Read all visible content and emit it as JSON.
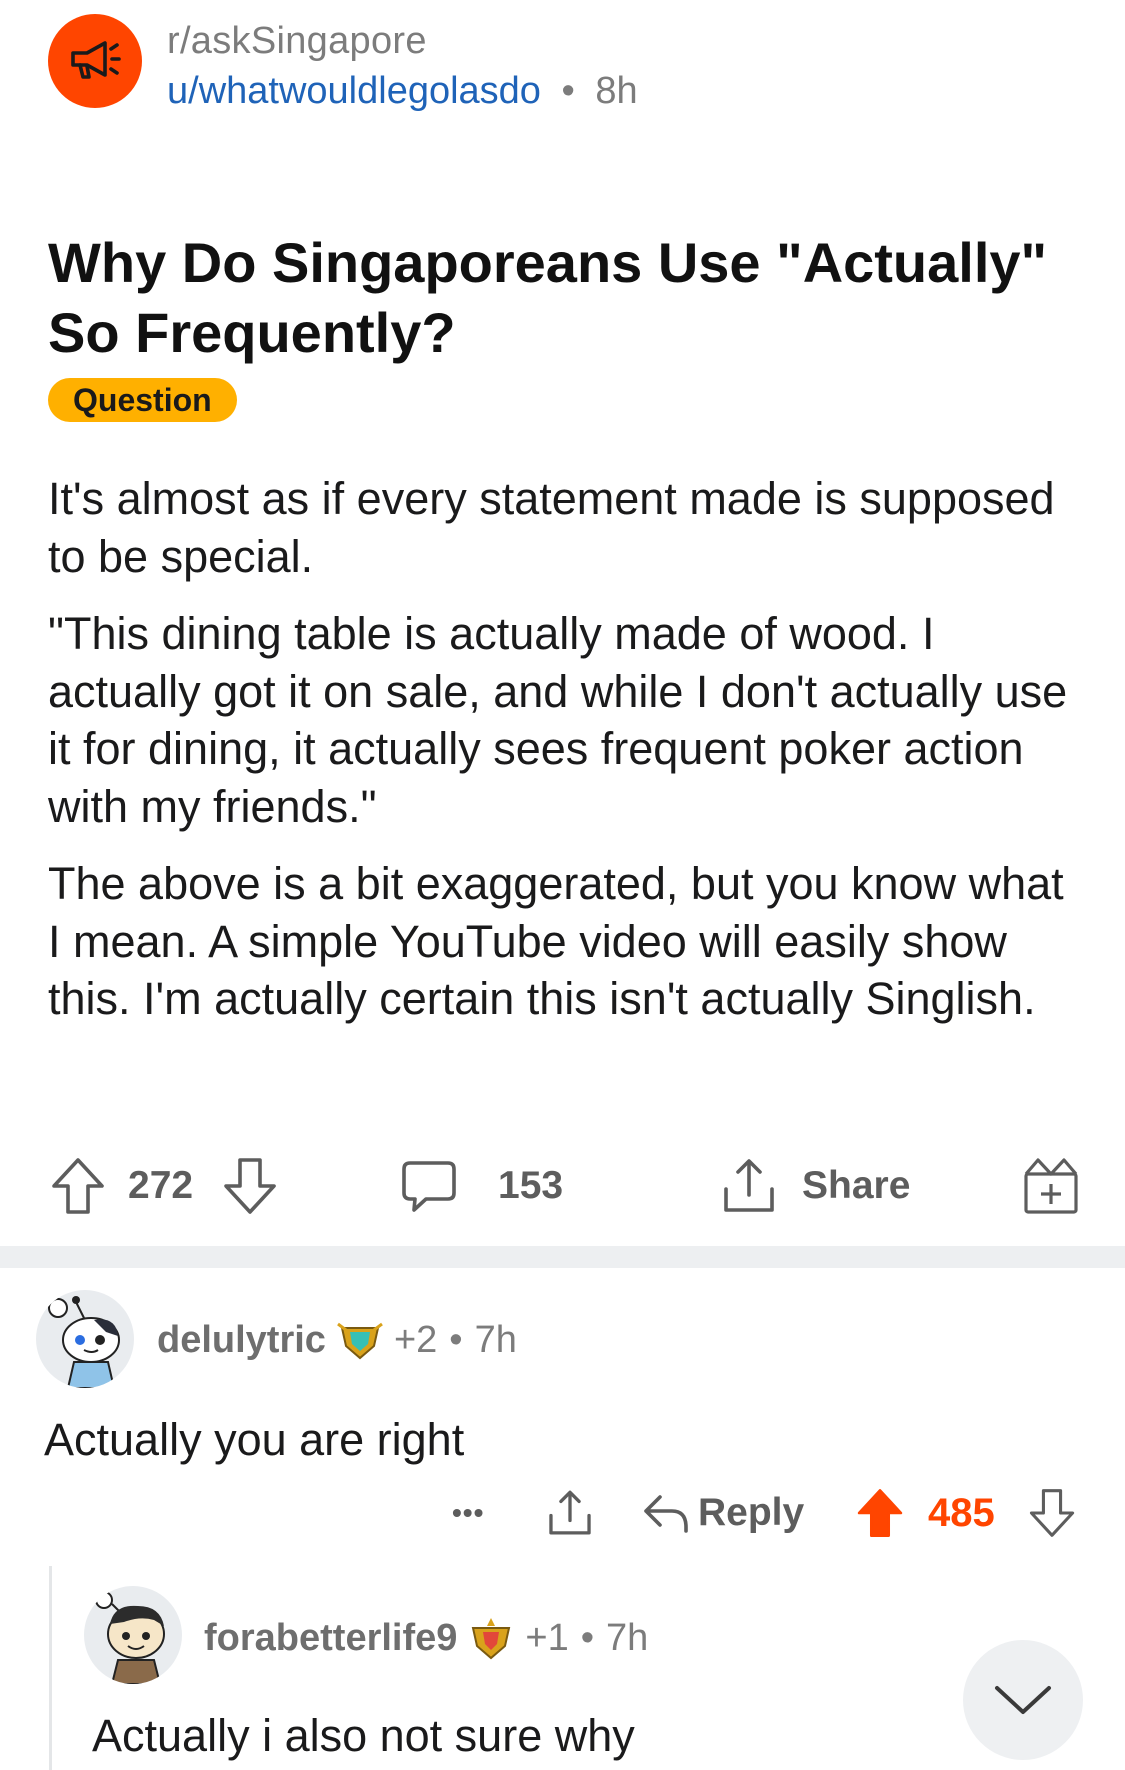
{
  "post": {
    "subreddit": "r/askSingapore",
    "author": "u/whatwouldlegolasdo",
    "separator": "•",
    "age": "8h",
    "title": "Why Do Singaporeans Use \"Actually\" So Frequently?",
    "flair": "Question",
    "flair_color": "#ffb000",
    "body": [
      "It's almost as if every statement made is supposed to be special.",
      "\"This dining table is actually made of wood. I actually got it on sale, and while I don't actually use it for dining, it actually sees frequent poker action with my friends.\"",
      "The above is a bit exaggerated, but you know what I mean. A simple YouTube video will easily show this. I'm actually certain this isn't actually Singlish."
    ],
    "votes": "272",
    "comments": "153",
    "share_label": "Share"
  },
  "comments": [
    {
      "username": "delulytric",
      "karma": "+2",
      "separator": "•",
      "age": "7h",
      "body": "Actually you are right",
      "more": "•••",
      "reply_label": "Reply",
      "score": "485",
      "score_color": "#ff4500"
    },
    {
      "username": "forabetterlife9",
      "karma": "+1",
      "separator": "•",
      "age": "7h",
      "body": "Actually i also not sure why"
    }
  ],
  "icons": {
    "subreddit": "megaphone-icon",
    "upvote": "arrow-up-icon",
    "downvote": "arrow-down-icon",
    "comment": "speech-bubble-icon",
    "share": "share-icon",
    "award": "gift-icon",
    "scroll": "chevron-down-icon"
  },
  "colors": {
    "accent": "#ff4500",
    "link": "#1f63b8",
    "muted": "#7c7c7c"
  }
}
